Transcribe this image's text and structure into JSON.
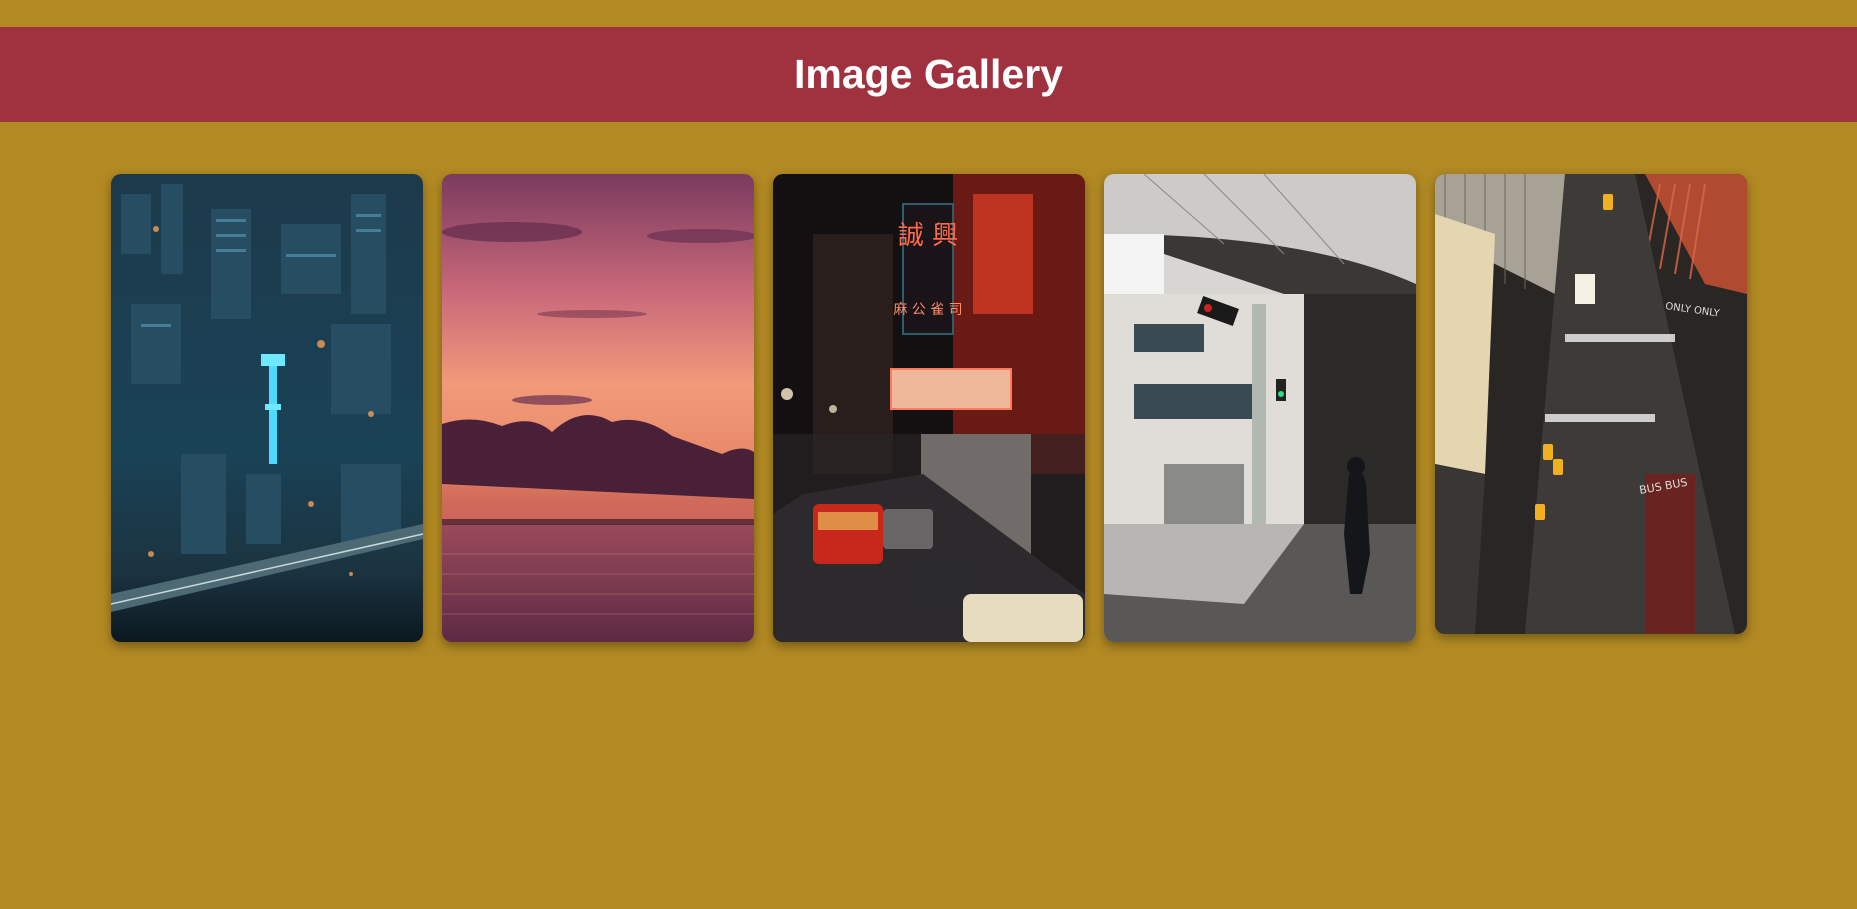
{
  "header": {
    "title": "Image Gallery",
    "background": "#a0323f"
  },
  "page": {
    "background": "#b28923"
  },
  "gallery": {
    "images": [
      {
        "subject": "city-night-tower",
        "dominant_color": "#1b4a5e"
      },
      {
        "subject": "sunset-sea",
        "dominant_color": "#c46a6a"
      },
      {
        "subject": "neon-street",
        "dominant_color": "#8a1a12"
      },
      {
        "subject": "building-traffic-light",
        "dominant_color": "#9a9a94"
      },
      {
        "subject": "aerial-street",
        "dominant_color": "#2a2422"
      }
    ]
  },
  "image_text": {
    "neon_sign": "誠 興",
    "neon_sub": "麻 公 雀 司",
    "road_marking_1": "ONLY ONLY",
    "road_marking_2": "BUS BUS"
  }
}
